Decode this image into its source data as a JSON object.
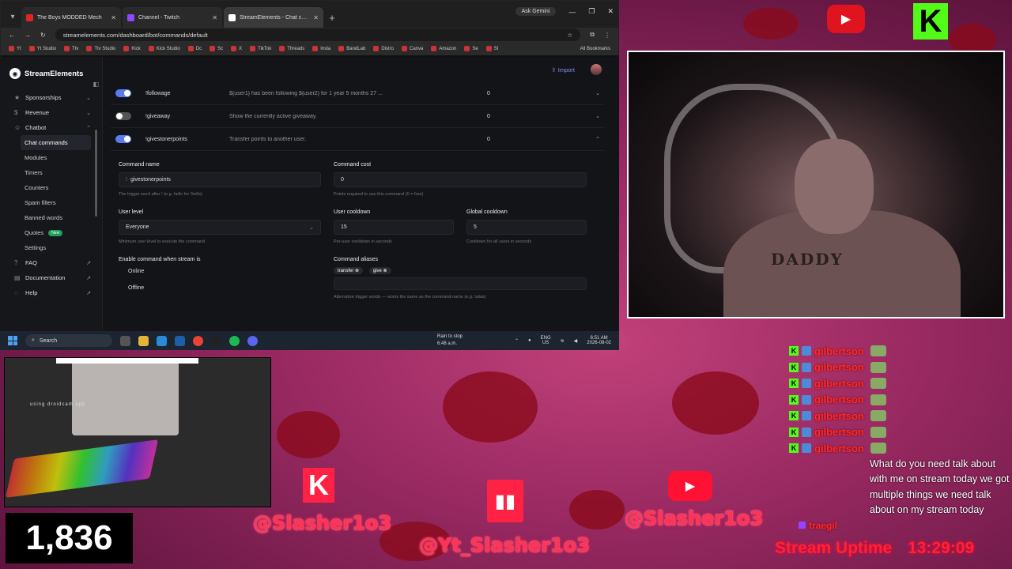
{
  "browser": {
    "tabs": [
      {
        "title": "The Boys MODDED Mech",
        "active": false,
        "color": "#e02424"
      },
      {
        "title": "Channel - Twitch",
        "active": false,
        "color": "#9146ff"
      },
      {
        "title": "StreamElements - Chat comma",
        "active": true,
        "color": "#ffffff"
      }
    ],
    "ask_label": "Ask Gemini",
    "url": "streamelements.com/dashboard/bot/commands/default",
    "bookmarks": [
      "Yt",
      "Yt Studio",
      "Ttv",
      "Ttv Studio",
      "Kick",
      "Kick Studio",
      "Dc",
      "Sc",
      "X",
      "TikTok",
      "Threads",
      "Insta",
      "BandLab",
      "Distro",
      "Canva",
      "Amazon",
      "Se",
      "Sl"
    ],
    "all_bookmarks": "All Bookmarks"
  },
  "app": {
    "brand": "StreamElements",
    "import_label": "Import",
    "nav": [
      {
        "label": "Sponsorships",
        "icon": "star-icon",
        "expandable": true
      },
      {
        "label": "Revenue",
        "icon": "dollar-icon",
        "expandable": true
      },
      {
        "label": "Chatbot",
        "icon": "bot-icon",
        "expandable": true,
        "expanded": true
      }
    ],
    "subnav": [
      {
        "label": "Chat commands",
        "active": true
      },
      {
        "label": "Modules"
      },
      {
        "label": "Timers"
      },
      {
        "label": "Counters"
      },
      {
        "label": "Spam filters"
      },
      {
        "label": "Banned words"
      },
      {
        "label": "Quotes",
        "badge": "New"
      },
      {
        "label": "Settings"
      }
    ],
    "bottom_nav": [
      {
        "label": "FAQ",
        "icon": "question-icon"
      },
      {
        "label": "Documentation",
        "icon": "doc-icon"
      },
      {
        "label": "Help",
        "icon": "help-icon"
      }
    ],
    "commands": [
      {
        "name": "!followage",
        "desc": "${user1} has been following ${user2} for 1 year 5 months 27 ...",
        "count": "0",
        "enabled": true,
        "expanded": false
      },
      {
        "name": "!giveaway",
        "desc": "Show the currently active giveaway.",
        "count": "0",
        "enabled": false,
        "expanded": false
      },
      {
        "name": "!givestonerpoints",
        "desc": "Transfer points to another user.",
        "count": "0",
        "enabled": true,
        "expanded": true
      }
    ],
    "detail": {
      "command_name_label": "Command name",
      "command_name_value": "givestonerpoints",
      "command_name_hint": "The trigger word after ! (e.g. hello for !hello)",
      "command_cost_label": "Command cost",
      "command_cost_value": "0",
      "command_cost_hint": "Points required to use this command (0 = free)",
      "user_level_label": "User level",
      "user_level_value": "Everyone",
      "user_level_hint": "Minimum user level to execute the command",
      "user_cooldown_label": "User cooldown",
      "user_cooldown_value": "15",
      "user_cooldown_hint": "Per-user cooldown in seconds",
      "global_cooldown_label": "Global cooldown",
      "global_cooldown_value": "5",
      "global_cooldown_hint": "Cooldown for all users in seconds",
      "stream_label": "Enable command when stream is",
      "online_label": "Online",
      "offline_label": "Offline",
      "aliases_label": "Command aliases",
      "aliases": [
        "transfer",
        "give"
      ],
      "aliases_hint": "Alternative trigger words — works the same as the command name (e.g. !alias)"
    }
  },
  "taskbar": {
    "search": "Search",
    "weather_title": "Rain to stop",
    "weather_time": "6:48 a.m.",
    "lang1": "ENG",
    "lang2": "US",
    "time": "6:51 AM",
    "date": "2026-08-02"
  },
  "overlay": {
    "droidcam": "using droidcam app",
    "viewers": "1,836",
    "kick_handle": "@Slasher1o3",
    "twitch_handle": "@Yt_Slasher1o3",
    "youtube_handle": "@Slasher1o3",
    "uptime": "Stream Uptime",
    "uptime_value": "13:29:09",
    "tattoo": "DADDY"
  },
  "chat": {
    "lines": [
      {
        "name": "gilbertson"
      },
      {
        "name": "gilbertson"
      },
      {
        "name": "gilbertson"
      },
      {
        "name": "gilbertson"
      },
      {
        "name": "gilbertson"
      },
      {
        "name": "gilbertson"
      },
      {
        "name": "gilbertson"
      }
    ],
    "message": "What do you need talk about with me on stream today we got multiple things we need talk about on my stream today",
    "twitch_user": "traegil"
  }
}
